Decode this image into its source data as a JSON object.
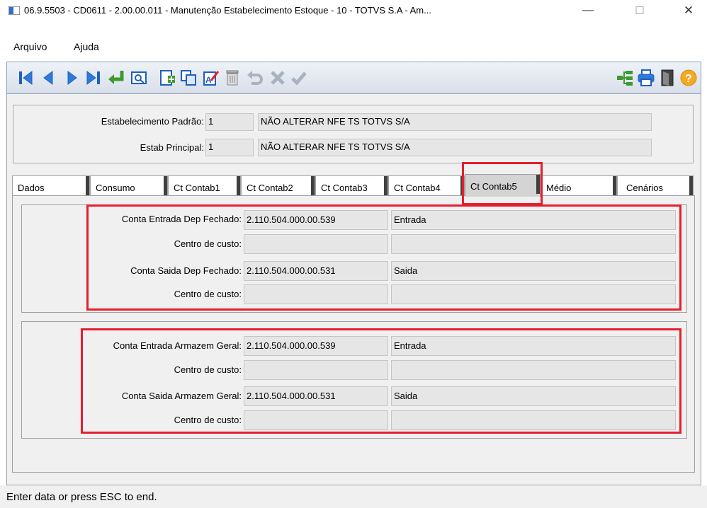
{
  "window": {
    "title": "06.9.5503 - CD0611 - 2.00.00.011 - Manutenção Estabelecimento Estoque - 10 - TOTVS S.A - Am...",
    "minimize": "—",
    "maximize": "☐",
    "close": "✕"
  },
  "menu": {
    "items": [
      "Arquivo",
      "Ajuda"
    ]
  },
  "toolbar": {
    "buttons": [
      "first-icon",
      "previous-icon",
      "next-icon",
      "last-icon",
      "goto-icon",
      "zoom-icon",
      "new-icon",
      "copy-icon",
      "edit-icon",
      "delete-icon",
      "undo-icon",
      "cancel-icon",
      "confirm-icon",
      "tree-icon",
      "print-icon",
      "exit-icon",
      "help-icon"
    ]
  },
  "header": {
    "estab_padrao_label": "Estabelecimento Padrão:",
    "estab_padrao_code": "1",
    "estab_padrao_name": "NÃO ALTERAR NFE TS TOTVS S/A",
    "estab_principal_label": "Estab Principal:",
    "estab_principal_code": "1",
    "estab_principal_name": "NÃO ALTERAR NFE TS TOTVS S/A"
  },
  "tabs": [
    "Dados",
    "Consumo",
    "Ct Contab1",
    "Ct Contab2",
    "Ct Contab3",
    "Ct Contab4",
    "Ct Contab5",
    "Médio",
    "Cenários"
  ],
  "active_tab": "Ct Contab5",
  "group1": {
    "row1_label": "Conta Entrada Dep Fechado:",
    "row1_value": "2.110.504.000.00.539",
    "row1_desc": "Entrada",
    "row2_label": "Centro de custo:",
    "row2_value": "",
    "row2_desc": "",
    "row3_label": "Conta Saida Dep Fechado:",
    "row3_value": "2.110.504.000.00.531",
    "row3_desc": "Saida",
    "row4_label": "Centro de custo:",
    "row4_value": "",
    "row4_desc": ""
  },
  "group2": {
    "row1_label": "Conta Entrada Armazem Geral:",
    "row1_value": "2.110.504.000.00.539",
    "row1_desc": "Entrada",
    "row2_label": "Centro de custo:",
    "row2_value": "",
    "row2_desc": "",
    "row3_label": "Conta Saida Armazem Geral:",
    "row3_value": "2.110.504.000.00.531",
    "row3_desc": "Saida",
    "row4_label": "Centro de custo:",
    "row4_value": "",
    "row4_desc": ""
  },
  "status": {
    "text": "Enter data or press ESC to end."
  },
  "colors": {
    "highlight": "#e51e2e",
    "toolbar_blue": "#1f5fbf",
    "toolbar_green": "#3c9a2e"
  }
}
